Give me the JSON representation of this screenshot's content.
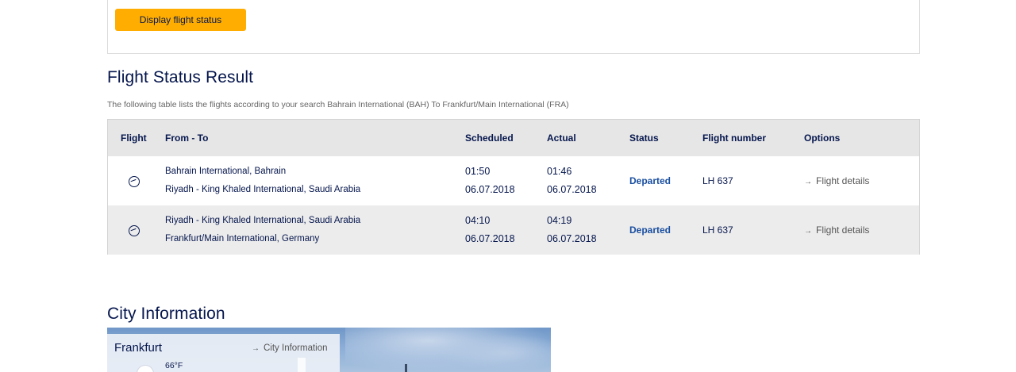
{
  "search": {
    "button_label": "Display flight status"
  },
  "result": {
    "title": "Flight Status Result",
    "description": "The following table lists the flights according to your search Bahrain International (BAH) To Frankfurt/Main International (FRA)",
    "headers": {
      "flight": "Flight",
      "from_to": "From - To",
      "scheduled": "Scheduled",
      "actual": "Actual",
      "status": "Status",
      "flight_number": "Flight number",
      "options": "Options"
    },
    "rows": [
      {
        "icon": "plane-icon",
        "from": "Bahrain International, Bahrain",
        "to": "Riyadh - King Khaled International, Saudi Arabia",
        "scheduled_time": "01:50",
        "scheduled_date": "06.07.2018",
        "actual_time": "01:46",
        "actual_date": "06.07.2018",
        "status": "Departed",
        "flight_number": "LH 637",
        "option_arrow": "→",
        "option": "Flight details"
      },
      {
        "icon": "plane-icon",
        "from": "Riyadh - King Khaled International, Saudi Arabia",
        "to": "Frankfurt/Main International, Germany",
        "scheduled_time": "04:10",
        "scheduled_date": "06.07.2018",
        "actual_time": "04:19",
        "actual_date": "06.07.2018",
        "status": "Departed",
        "flight_number": "LH 637",
        "option_arrow": "→",
        "option": "Flight details"
      }
    ]
  },
  "city": {
    "title": "City Information",
    "name": "Frankfurt",
    "link_arrow": "→",
    "link": "City Information",
    "temperature": "66°F",
    "weather_icon": "cloud-icon"
  },
  "colors": {
    "accent_button": "#ffad00",
    "brand_navy": "#05164d",
    "status_blue": "#1a4fa0",
    "header_bg": "#e6e6e6",
    "alt_row_bg": "#ececec"
  }
}
